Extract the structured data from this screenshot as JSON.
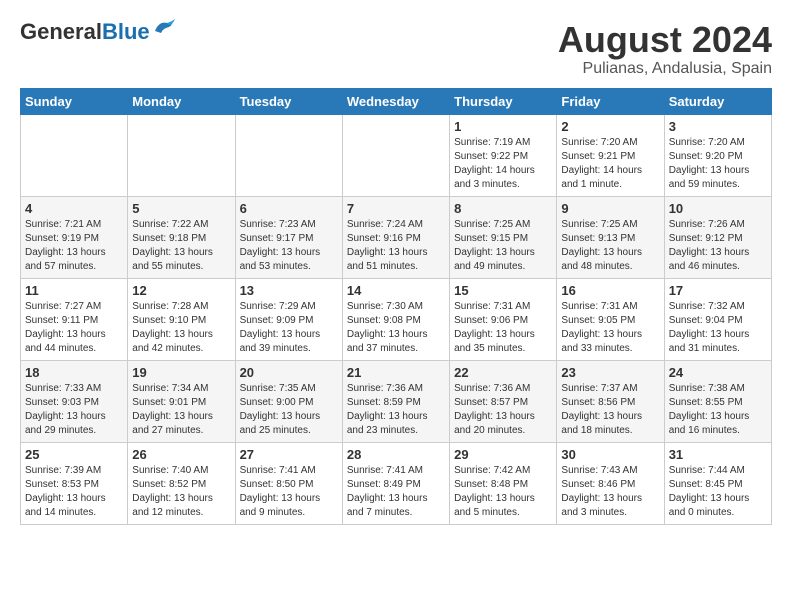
{
  "logo": {
    "general": "General",
    "blue": "Blue"
  },
  "title": "August 2024",
  "subtitle": "Pulianas, Andalusia, Spain",
  "weekdays": [
    "Sunday",
    "Monday",
    "Tuesday",
    "Wednesday",
    "Thursday",
    "Friday",
    "Saturday"
  ],
  "weeks": [
    [
      {
        "day": "",
        "info": ""
      },
      {
        "day": "",
        "info": ""
      },
      {
        "day": "",
        "info": ""
      },
      {
        "day": "",
        "info": ""
      },
      {
        "day": "1",
        "info": "Sunrise: 7:19 AM\nSunset: 9:22 PM\nDaylight: 14 hours\nand 3 minutes."
      },
      {
        "day": "2",
        "info": "Sunrise: 7:20 AM\nSunset: 9:21 PM\nDaylight: 14 hours\nand 1 minute."
      },
      {
        "day": "3",
        "info": "Sunrise: 7:20 AM\nSunset: 9:20 PM\nDaylight: 13 hours\nand 59 minutes."
      }
    ],
    [
      {
        "day": "4",
        "info": "Sunrise: 7:21 AM\nSunset: 9:19 PM\nDaylight: 13 hours\nand 57 minutes."
      },
      {
        "day": "5",
        "info": "Sunrise: 7:22 AM\nSunset: 9:18 PM\nDaylight: 13 hours\nand 55 minutes."
      },
      {
        "day": "6",
        "info": "Sunrise: 7:23 AM\nSunset: 9:17 PM\nDaylight: 13 hours\nand 53 minutes."
      },
      {
        "day": "7",
        "info": "Sunrise: 7:24 AM\nSunset: 9:16 PM\nDaylight: 13 hours\nand 51 minutes."
      },
      {
        "day": "8",
        "info": "Sunrise: 7:25 AM\nSunset: 9:15 PM\nDaylight: 13 hours\nand 49 minutes."
      },
      {
        "day": "9",
        "info": "Sunrise: 7:25 AM\nSunset: 9:13 PM\nDaylight: 13 hours\nand 48 minutes."
      },
      {
        "day": "10",
        "info": "Sunrise: 7:26 AM\nSunset: 9:12 PM\nDaylight: 13 hours\nand 46 minutes."
      }
    ],
    [
      {
        "day": "11",
        "info": "Sunrise: 7:27 AM\nSunset: 9:11 PM\nDaylight: 13 hours\nand 44 minutes."
      },
      {
        "day": "12",
        "info": "Sunrise: 7:28 AM\nSunset: 9:10 PM\nDaylight: 13 hours\nand 42 minutes."
      },
      {
        "day": "13",
        "info": "Sunrise: 7:29 AM\nSunset: 9:09 PM\nDaylight: 13 hours\nand 39 minutes."
      },
      {
        "day": "14",
        "info": "Sunrise: 7:30 AM\nSunset: 9:08 PM\nDaylight: 13 hours\nand 37 minutes."
      },
      {
        "day": "15",
        "info": "Sunrise: 7:31 AM\nSunset: 9:06 PM\nDaylight: 13 hours\nand 35 minutes."
      },
      {
        "day": "16",
        "info": "Sunrise: 7:31 AM\nSunset: 9:05 PM\nDaylight: 13 hours\nand 33 minutes."
      },
      {
        "day": "17",
        "info": "Sunrise: 7:32 AM\nSunset: 9:04 PM\nDaylight: 13 hours\nand 31 minutes."
      }
    ],
    [
      {
        "day": "18",
        "info": "Sunrise: 7:33 AM\nSunset: 9:03 PM\nDaylight: 13 hours\nand 29 minutes."
      },
      {
        "day": "19",
        "info": "Sunrise: 7:34 AM\nSunset: 9:01 PM\nDaylight: 13 hours\nand 27 minutes."
      },
      {
        "day": "20",
        "info": "Sunrise: 7:35 AM\nSunset: 9:00 PM\nDaylight: 13 hours\nand 25 minutes."
      },
      {
        "day": "21",
        "info": "Sunrise: 7:36 AM\nSunset: 8:59 PM\nDaylight: 13 hours\nand 23 minutes."
      },
      {
        "day": "22",
        "info": "Sunrise: 7:36 AM\nSunset: 8:57 PM\nDaylight: 13 hours\nand 20 minutes."
      },
      {
        "day": "23",
        "info": "Sunrise: 7:37 AM\nSunset: 8:56 PM\nDaylight: 13 hours\nand 18 minutes."
      },
      {
        "day": "24",
        "info": "Sunrise: 7:38 AM\nSunset: 8:55 PM\nDaylight: 13 hours\nand 16 minutes."
      }
    ],
    [
      {
        "day": "25",
        "info": "Sunrise: 7:39 AM\nSunset: 8:53 PM\nDaylight: 13 hours\nand 14 minutes."
      },
      {
        "day": "26",
        "info": "Sunrise: 7:40 AM\nSunset: 8:52 PM\nDaylight: 13 hours\nand 12 minutes."
      },
      {
        "day": "27",
        "info": "Sunrise: 7:41 AM\nSunset: 8:50 PM\nDaylight: 13 hours\nand 9 minutes."
      },
      {
        "day": "28",
        "info": "Sunrise: 7:41 AM\nSunset: 8:49 PM\nDaylight: 13 hours\nand 7 minutes."
      },
      {
        "day": "29",
        "info": "Sunrise: 7:42 AM\nSunset: 8:48 PM\nDaylight: 13 hours\nand 5 minutes."
      },
      {
        "day": "30",
        "info": "Sunrise: 7:43 AM\nSunset: 8:46 PM\nDaylight: 13 hours\nand 3 minutes."
      },
      {
        "day": "31",
        "info": "Sunrise: 7:44 AM\nSunset: 8:45 PM\nDaylight: 13 hours\nand 0 minutes."
      }
    ]
  ]
}
